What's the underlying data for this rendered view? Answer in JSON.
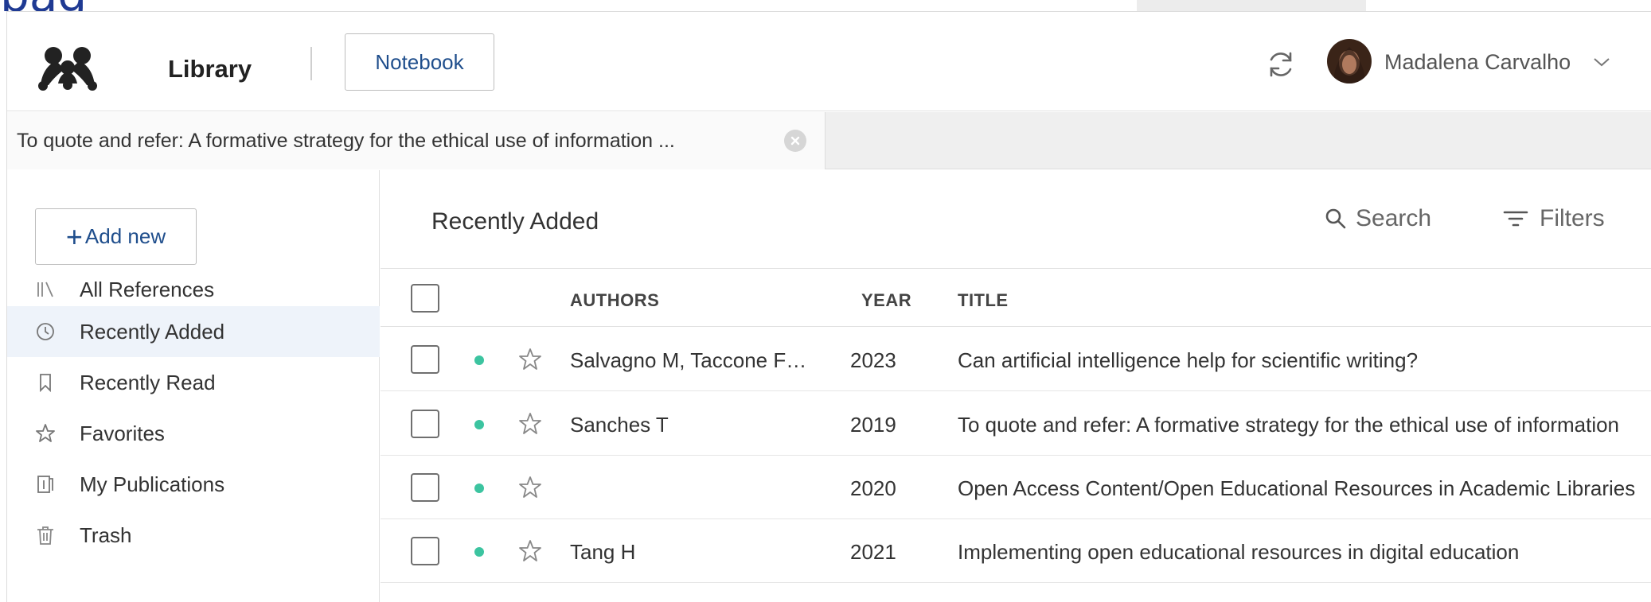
{
  "colors": {
    "accent": "#1f4e8c",
    "active_nav_bg": "#eef3fa",
    "unread_dot": "#3cc4a0",
    "heading_blue": "#1f3a93"
  },
  "header": {
    "title": "Library",
    "notebook_label": "Notebook",
    "user_name": "Madalena Carvalho",
    "icons": [
      "mendeley-logo-icon",
      "sync-icon",
      "chevron-down-icon"
    ]
  },
  "tab": {
    "label": "To quote and refer: A formative strategy for the ethical use of information ...",
    "close_icon": "close-circle-icon"
  },
  "sidebar": {
    "add_new_label": "Add new",
    "items": [
      {
        "label": "All References",
        "icon": "library-books-icon",
        "active": false
      },
      {
        "label": "Recently Added",
        "icon": "clock-icon",
        "active": true
      },
      {
        "label": "Recently Read",
        "icon": "bookmark-icon",
        "active": false
      },
      {
        "label": "Favorites",
        "icon": "star-icon",
        "active": false
      },
      {
        "label": "My Publications",
        "icon": "publications-icon",
        "active": false
      },
      {
        "label": "Trash",
        "icon": "trash-icon",
        "active": false
      }
    ]
  },
  "main": {
    "section_title": "Recently Added",
    "search_label": "Search",
    "filters_label": "Filters",
    "columns": {
      "authors": "AUTHORS",
      "year": "YEAR",
      "title": "TITLE"
    },
    "rows": [
      {
        "authors": "Salvagno M, Taccone F…",
        "year": "2023",
        "title": "Can artificial intelligence help for scientific writing?",
        "unread": true,
        "favorite": false
      },
      {
        "authors": "Sanches T",
        "year": "2019",
        "title": "To quote and refer: A formative strategy for the ethical use of information",
        "unread": true,
        "favorite": false
      },
      {
        "authors": "",
        "year": "2020",
        "title": "Open Access Content/Open Educational Resources in Academic Libraries",
        "unread": true,
        "favorite": false
      },
      {
        "authors": "Tang H",
        "year": "2021",
        "title": "Implementing open educational resources in digital education",
        "unread": true,
        "favorite": false
      }
    ]
  }
}
